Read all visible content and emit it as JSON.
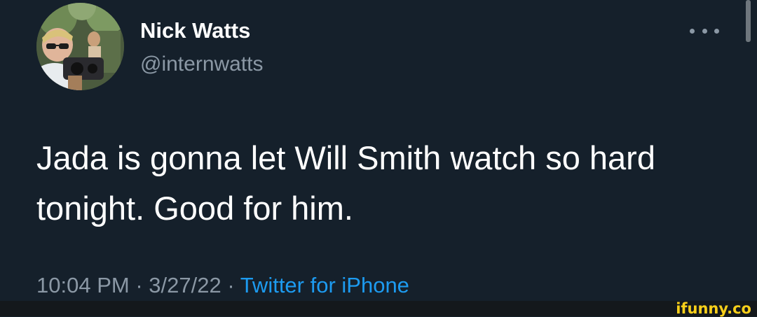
{
  "tweet": {
    "author": {
      "display_name": "Nick Watts",
      "handle": "@internwatts",
      "avatar_icon": "profile-photo"
    },
    "text": "Jada is gonna let Will Smith watch so hard\ntonight. Good for him.",
    "timestamp": {
      "time": "10:04 PM",
      "separator_1": " · ",
      "date": "3/27/22",
      "separator_2": " · ",
      "source": "Twitter for iPhone"
    },
    "more_icon": "more-horizontal-icon"
  },
  "footer": {
    "watermark": "ifunny.co"
  },
  "colors": {
    "background": "#15202b",
    "text": "#ffffff",
    "secondary_text": "#8b98a5",
    "link": "#1d9bf0",
    "watermark": "#f8cf1a"
  }
}
